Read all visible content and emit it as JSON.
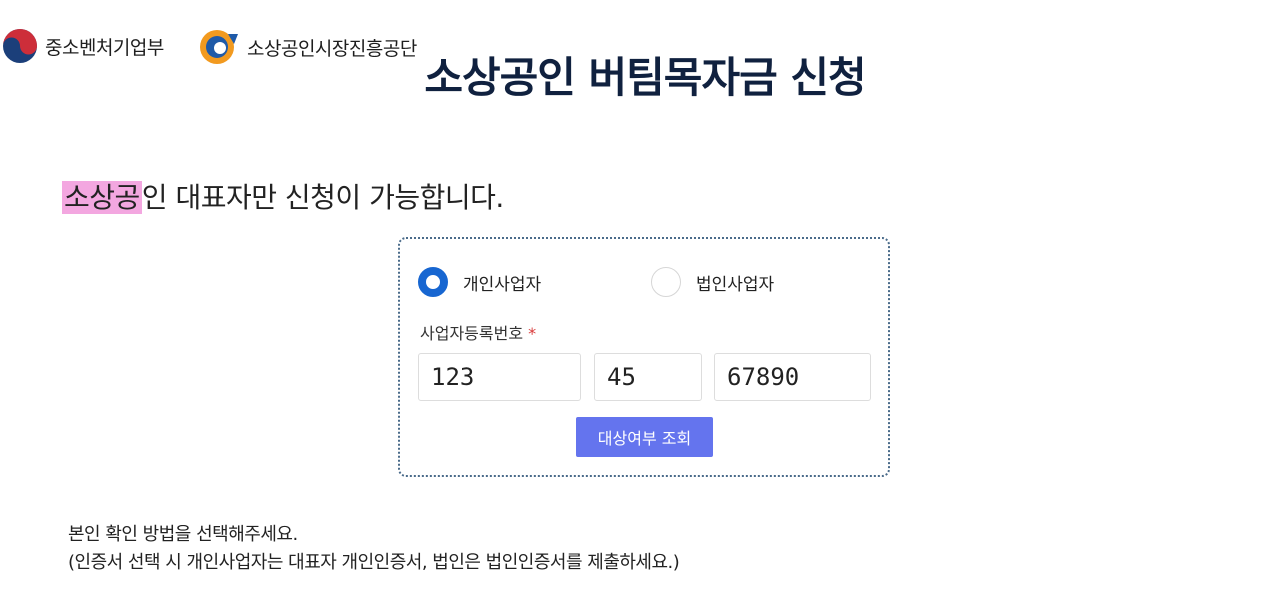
{
  "header": {
    "ministry_logo_text": "중소벤처기업부",
    "agency_logo_text": "소상공인시장진흥공단",
    "title": "소상공인 버팀목자금 신청"
  },
  "notice": {
    "highlight": "소상공",
    "rest": "인 대표자만 신청이 가능합니다."
  },
  "form": {
    "applicant_types": [
      {
        "label": "개인사업자",
        "selected": true
      },
      {
        "label": "법인사업자",
        "selected": false
      }
    ],
    "biz_number_label": "사업자등록번호",
    "required_mark": "*",
    "biz_number_parts": [
      "123",
      "45",
      "67890"
    ],
    "check_button_label": "대상여부 조회"
  },
  "guide": {
    "line1": "본인 확인 방법을 선택해주세요.",
    "line2": "(인증서 선택 시 개인사업자는 대표자 개인인증서, 법인은 법인인증서를 제출하세요.)"
  },
  "colors": {
    "title": "#10213f",
    "radio_selected": "#1766d1",
    "button": "#6474ee",
    "highlight": "#f3a7e0",
    "box_border": "#4a6b8a"
  },
  "icons": {
    "ministry_logo": "taegeuk-emblem-icon",
    "agency_logo": "semas-emblem-icon"
  }
}
